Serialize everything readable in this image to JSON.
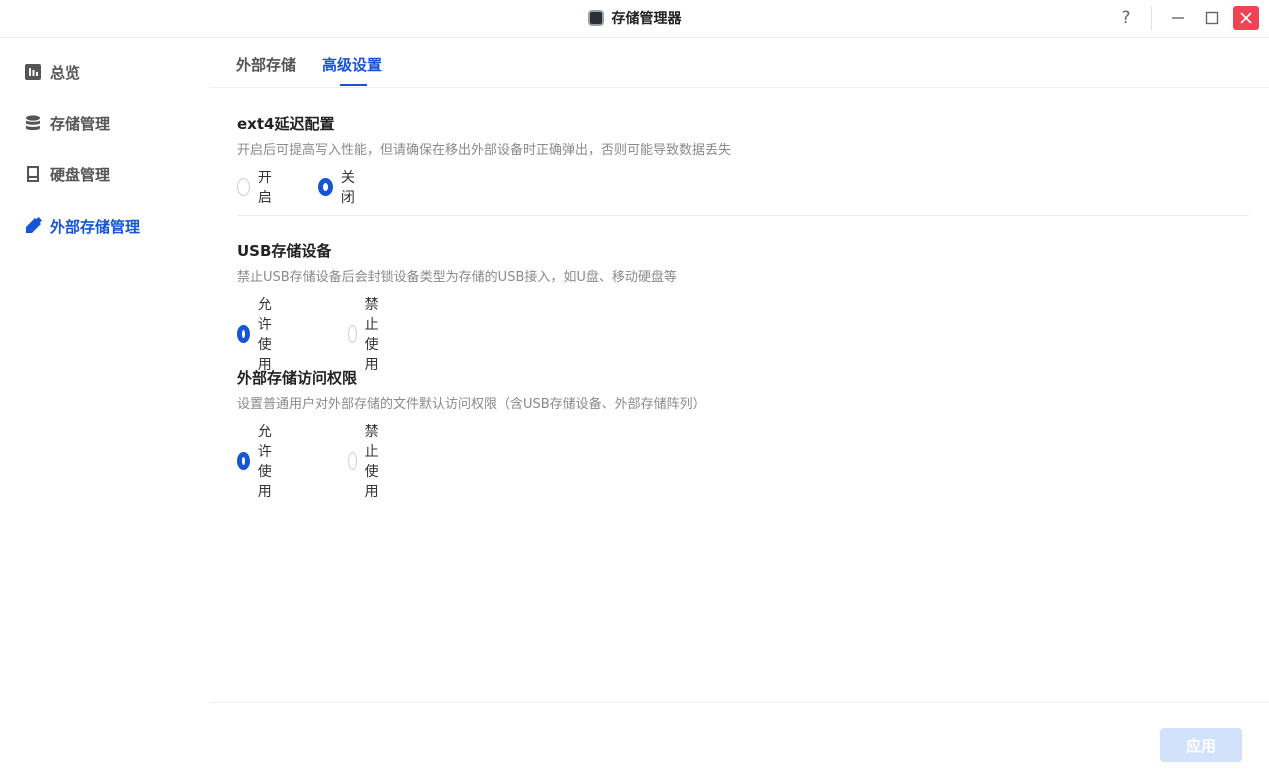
{
  "window": {
    "title": "存储管理器",
    "help_label": "?"
  },
  "sidebar": {
    "items": [
      {
        "label": "总览",
        "icon": "chart-icon"
      },
      {
        "label": "存储管理",
        "icon": "database-icon"
      },
      {
        "label": "硬盘管理",
        "icon": "disk-icon"
      },
      {
        "label": "外部存储管理",
        "icon": "usb-drive-icon",
        "active": true
      }
    ]
  },
  "tabs": [
    {
      "label": "外部存储"
    },
    {
      "label": "高级设置",
      "active": true
    }
  ],
  "sections": [
    {
      "title": "ext4延迟配置",
      "description": "开启后可提高写入性能，但请确保在移出外部设备时正确弹出，否则可能导致数据丢失",
      "options": [
        "开启",
        "关闭"
      ],
      "selected": "关闭"
    },
    {
      "title": "USB存储设备",
      "description": "禁止USB存储设备后会封锁设备类型为存储的USB接入，如U盘、移动硬盘等",
      "options": [
        "允许使用",
        "禁止使用"
      ],
      "selected": "允许使用"
    },
    {
      "title": "外部存储访问权限",
      "description": "设置普通用户对外部存储的文件默认访问权限（含USB存储设备、外部存储阵列）",
      "options": [
        "允许使用",
        "禁止使用"
      ],
      "selected": "允许使用"
    }
  ],
  "footer": {
    "apply_label": "应用"
  },
  "colors": {
    "accent": "#1755d8",
    "close": "#f04454",
    "apply_disabled": "#d2e2fb"
  }
}
